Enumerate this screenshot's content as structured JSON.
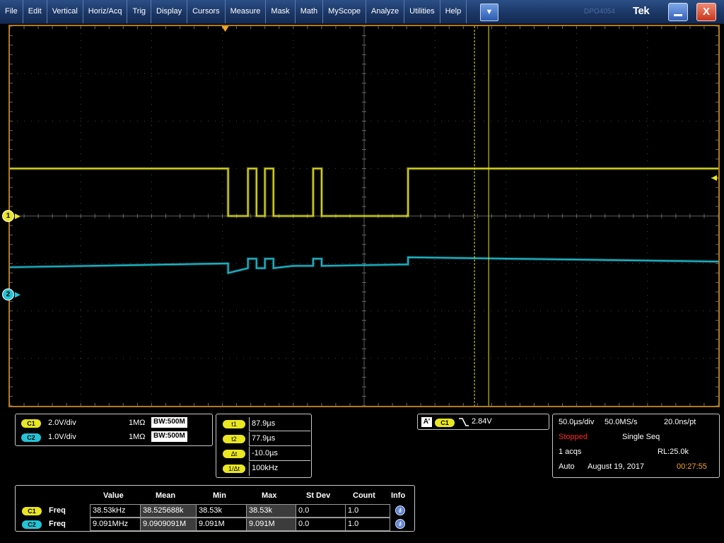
{
  "menubar": {
    "items": [
      "File",
      "Edit",
      "Vertical",
      "Horiz/Acq",
      "Trig",
      "Display",
      "Cursors",
      "Measure",
      "Mask",
      "Math",
      "MyScope",
      "Analyze",
      "Utilities",
      "Help"
    ],
    "dropdown_glyph": "▼",
    "model_text": "DPO4054",
    "brand": "Tek",
    "close_glyph": "X"
  },
  "colors": {
    "ch1": "#e9e622",
    "ch2": "#22c4d6",
    "frame": "#b57a1a",
    "grid": "#4a4a4a",
    "cursor": "#e9e622"
  },
  "channel_markers": {
    "ch1": "1",
    "ch2": "2"
  },
  "vertical": [
    {
      "ch": "C1",
      "scale": "2.0V/div",
      "impedance": "1MΩ",
      "bw": "BW:500M"
    },
    {
      "ch": "C2",
      "scale": "1.0V/div",
      "impedance": "1MΩ",
      "bw": "BW:500M"
    }
  ],
  "cursors": [
    {
      "label": "t1",
      "value": "87.9µs"
    },
    {
      "label": "t2",
      "value": "77.9µs"
    },
    {
      "label": "Δt",
      "value": "-10.0µs"
    },
    {
      "label": "1/Δt",
      "value": "100kHz"
    }
  ],
  "trigger": {
    "mode_label": "A'",
    "source": "C1",
    "slope": "falling",
    "level": "2.84V"
  },
  "horizontal": {
    "time_div": "50.0µs/div",
    "sample_rate": "50.0MS/s",
    "resolution": "20.0ns/pt",
    "run_state": "Stopped",
    "acq_mode": "Single Seq",
    "acqs": "1 acqs",
    "record_length": "RL:25.0k",
    "trigger_mode": "Auto",
    "date": "August 19, 2017",
    "time": "00:27:55"
  },
  "measurements": {
    "headers": [
      "Value",
      "Mean",
      "Min",
      "Max",
      "St Dev",
      "Count",
      "Info"
    ],
    "rows": [
      {
        "ch": "C1",
        "type": "Freq",
        "value": "38.53kHz",
        "mean": "38.525688k",
        "min": "38.53k",
        "max": "38.53k",
        "stdev": "0.0",
        "count": "1.0",
        "info": "i"
      },
      {
        "ch": "C2",
        "type": "Freq",
        "value": "9.091MHz",
        "mean": "9.0909091M",
        "min": "9.091M",
        "max": "9.091M",
        "stdev": "0.0",
        "count": "1.0",
        "info": "i"
      }
    ]
  },
  "chart_data": {
    "type": "line",
    "xlabel": "",
    "ylabel": "",
    "x_unit": "µs",
    "y_unit": "div",
    "xlim": [
      -250,
      250
    ],
    "ylim": [
      -4,
      4
    ],
    "grid": true,
    "series": [
      {
        "name": "C1",
        "x": [
          -250,
          -96,
          -96,
          -82,
          -82,
          -76,
          -76,
          -70,
          -70,
          -64,
          -64,
          -50,
          -50,
          -36,
          -36,
          -30,
          -30,
          31,
          31,
          250
        ],
        "y": [
          1.0,
          1.0,
          0.0,
          0.0,
          1.0,
          1.0,
          0.0,
          0.0,
          1.0,
          1.0,
          0.0,
          0.0,
          0.0,
          0.0,
          1.0,
          1.0,
          0.0,
          0.0,
          1.0,
          1.0
        ]
      },
      {
        "name": "C2",
        "x": [
          -250,
          -96,
          -96,
          -82,
          -82,
          -76,
          -76,
          -70,
          -70,
          -64,
          -64,
          -50,
          -50,
          -36,
          -36,
          -30,
          -30,
          31,
          31,
          250
        ],
        "y": [
          -1.08,
          -1.0,
          -1.2,
          -1.1,
          -0.9,
          -0.9,
          -1.1,
          -1.1,
          -0.9,
          -0.9,
          -1.1,
          -1.05,
          -1.05,
          -1.05,
          -0.9,
          -0.9,
          -1.05,
          -1.02,
          -0.87,
          -0.96
        ]
      }
    ],
    "cursors_x": [
      77.9,
      87.9
    ],
    "trigger_x": -98,
    "trigger_level_div": 0.8
  }
}
